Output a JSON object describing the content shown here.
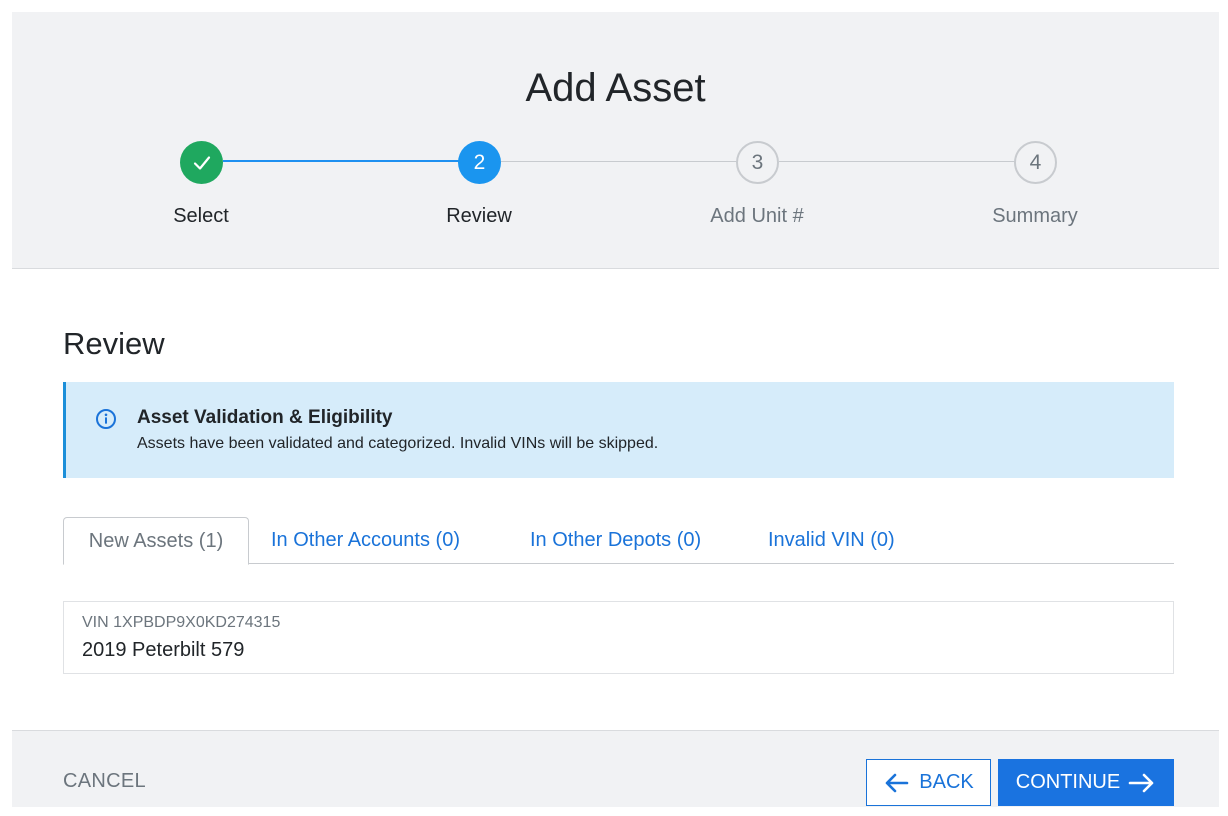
{
  "modal": {
    "title": "Add Asset"
  },
  "stepper": {
    "steps": [
      {
        "number": "1",
        "label": "Select",
        "state": "complete"
      },
      {
        "number": "2",
        "label": "Review",
        "state": "active"
      },
      {
        "number": "3",
        "label": "Add Unit #",
        "state": "pending"
      },
      {
        "number": "4",
        "label": "Summary",
        "state": "pending"
      }
    ]
  },
  "review": {
    "title": "Review",
    "alert": {
      "icon": "info-icon",
      "title": "Asset Validation & Eligibility",
      "text": "Assets have been validated and categorized. Invalid VINs will be skipped."
    },
    "tabs": [
      {
        "label": "New Assets (1)",
        "active": true
      },
      {
        "label": "In Other Accounts (0)",
        "active": false
      },
      {
        "label": "In Other Depots (0)",
        "active": false
      },
      {
        "label": "Invalid VIN (0)",
        "active": false
      }
    ],
    "assets": [
      {
        "vin": "VIN 1XPBDP9X0KD274315",
        "name": "2019 Peterbilt 579"
      }
    ]
  },
  "footer": {
    "cancel_label": "CANCEL",
    "back_label": "BACK",
    "continue_label": "CONTINUE"
  },
  "colors": {
    "complete": "#1fa85f",
    "active": "#1a95ef",
    "link": "#1a73d9",
    "primary_button": "#1a73e0",
    "alert_background": "#d6ecfa"
  }
}
